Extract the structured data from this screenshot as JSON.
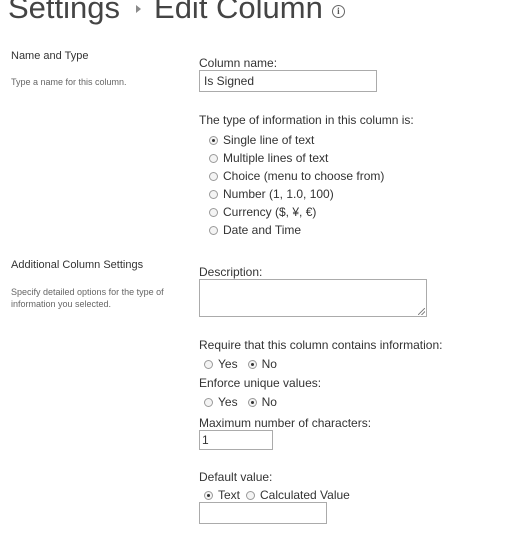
{
  "header": {
    "breadcrumb_root": "Settings",
    "page_title": "Edit Column"
  },
  "name_and_type": {
    "section_title": "Name and Type",
    "section_description": "Type a name for this column.",
    "column_name_label": "Column name:",
    "column_name_value": "Is Signed",
    "type_label": "The type of information in this column is:",
    "type_options": [
      {
        "label": "Single line of text",
        "selected": true
      },
      {
        "label": "Multiple lines of text",
        "selected": false
      },
      {
        "label": "Choice (menu to choose from)",
        "selected": false
      },
      {
        "label": "Number (1, 1.0, 100)",
        "selected": false
      },
      {
        "label": "Currency ($, ¥, €)",
        "selected": false
      },
      {
        "label": "Date and Time",
        "selected": false
      }
    ]
  },
  "additional_settings": {
    "section_title": "Additional Column Settings",
    "section_description": "Specify detailed options for the type of information you selected.",
    "description_label": "Description:",
    "description_value": "",
    "require_label": "Require that this column contains information:",
    "require_options": [
      {
        "label": "Yes",
        "selected": false
      },
      {
        "label": "No",
        "selected": true
      }
    ],
    "unique_label": "Enforce unique values:",
    "unique_options": [
      {
        "label": "Yes",
        "selected": false
      },
      {
        "label": "No",
        "selected": true
      }
    ],
    "max_chars_label": "Maximum number of characters:",
    "max_chars_value": "1",
    "default_value_label": "Default value:",
    "default_value_options": [
      {
        "label": "Text",
        "selected": true
      },
      {
        "label": "Calculated Value",
        "selected": false
      }
    ],
    "default_value_text": ""
  }
}
